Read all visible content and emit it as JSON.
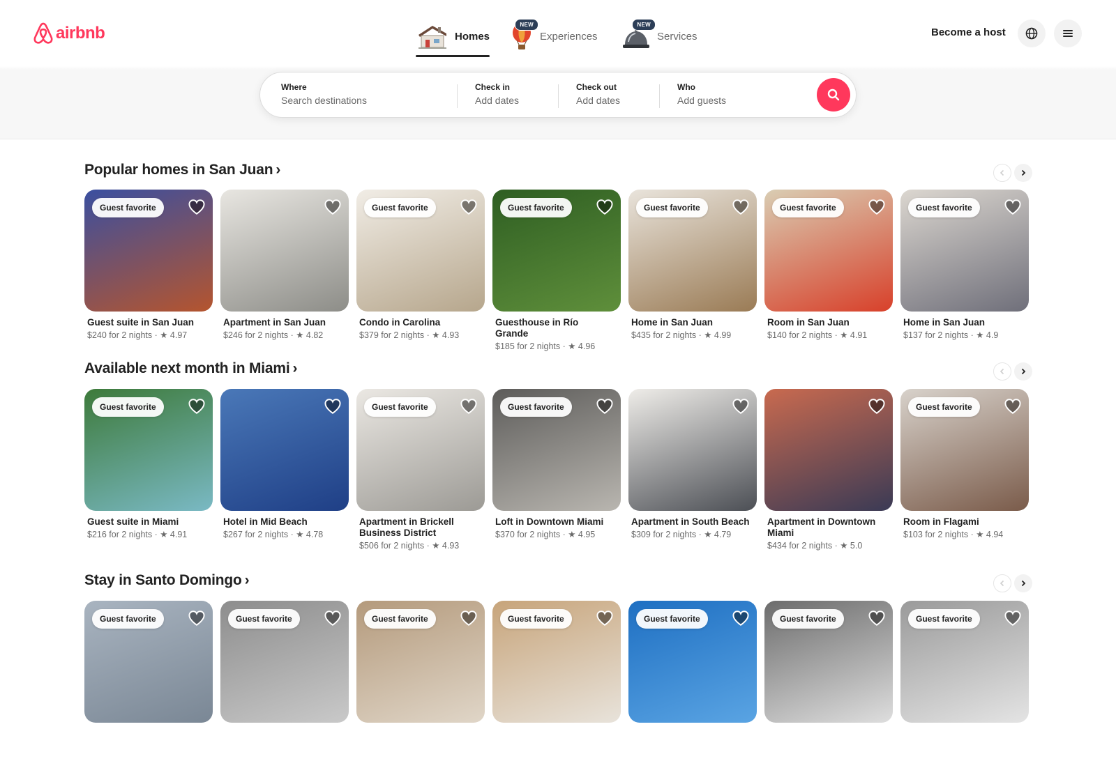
{
  "brand": {
    "name": "airbnb",
    "color": "#ff385c"
  },
  "nav": {
    "tabs": [
      {
        "label": "Homes",
        "icon": "house-icon",
        "active": true,
        "badge": ""
      },
      {
        "label": "Experiences",
        "icon": "hot-air-balloon-icon",
        "active": false,
        "badge": "NEW"
      },
      {
        "label": "Services",
        "icon": "service-bell-icon",
        "active": false,
        "badge": "NEW"
      }
    ],
    "become_host": "Become a host",
    "globe_icon": "globe-icon",
    "menu_icon": "hamburger-menu-icon"
  },
  "search": {
    "where_label": "Where",
    "where_placeholder": "Search destinations",
    "checkin_label": "Check in",
    "checkin_placeholder": "Add dates",
    "checkout_label": "Check out",
    "checkout_placeholder": "Add dates",
    "who_label": "Who",
    "who_placeholder": "Add guests",
    "button_icon": "search-icon"
  },
  "sections": [
    {
      "title": "Popular homes in San Juan",
      "listings": [
        {
          "title": "Guest suite in San Juan",
          "meta": "$240 for 2 nights · ★ 4.97",
          "badge": "Guest favorite",
          "c1": "#3a4fa0",
          "c2": "#b5552e"
        },
        {
          "title": "Apartment in San Juan",
          "meta": "$246 for 2 nights · ★ 4.82",
          "badge": "",
          "c1": "#e8e6e1",
          "c2": "#8d8d88"
        },
        {
          "title": "Condo in Carolina",
          "meta": "$379 for 2 nights · ★ 4.93",
          "badge": "Guest favorite",
          "c1": "#f1ede6",
          "c2": "#b6a68c"
        },
        {
          "title": "Guesthouse in Río Grande",
          "meta": "$185 for 2 nights · ★ 4.96",
          "badge": "Guest favorite",
          "c1": "#2e5e22",
          "c2": "#5f8f3b"
        },
        {
          "title": "Home in San Juan",
          "meta": "$435 for 2 nights · ★ 4.99",
          "badge": "Guest favorite",
          "c1": "#e9e4dc",
          "c2": "#9a7b55"
        },
        {
          "title": "Room in San Juan",
          "meta": "$140 for 2 nights · ★ 4.91",
          "badge": "Guest favorite",
          "c1": "#d9cdb3",
          "c2": "#d8402a"
        },
        {
          "title": "Home in San Juan",
          "meta": "$137 for 2 nights · ★ 4.9",
          "badge": "Guest favorite",
          "c1": "#dcd7d0",
          "c2": "#6f6f7a"
        }
      ]
    },
    {
      "title": "Available next month in Miami",
      "listings": [
        {
          "title": "Guest suite in Miami",
          "meta": "$216 for 2 nights · ★ 4.91",
          "badge": "Guest favorite",
          "c1": "#3d7a3a",
          "c2": "#7ab9c4"
        },
        {
          "title": "Hotel in Mid Beach",
          "meta": "$267 for 2 nights · ★ 4.78",
          "badge": "",
          "c1": "#4a78b8",
          "c2": "#1f3f86"
        },
        {
          "title": "Apartment in Brickell Business District",
          "meta": "$506 for 2 nights · ★ 4.93",
          "badge": "Guest favorite",
          "c1": "#ebe8e3",
          "c2": "#9c9a95"
        },
        {
          "title": "Loft in Downtown Miami",
          "meta": "$370 for 2 nights · ★ 4.95",
          "badge": "Guest favorite",
          "c1": "#5d5c5a",
          "c2": "#b9b6b0"
        },
        {
          "title": "Apartment in South Beach",
          "meta": "$309 for 2 nights · ★ 4.79",
          "badge": "",
          "c1": "#efede9",
          "c2": "#4c4f55"
        },
        {
          "title": "Apartment in Downtown Miami",
          "meta": "$434 for 2 nights · ★ 5.0",
          "badge": "",
          "c1": "#c96a4f",
          "c2": "#3a3a55"
        },
        {
          "title": "Room in Flagami",
          "meta": "$103 for 2 nights · ★ 4.94",
          "badge": "Guest favorite",
          "c1": "#d8d2cb",
          "c2": "#7a5b4a"
        }
      ]
    },
    {
      "title": "Stay in Santo Domingo",
      "listings": [
        {
          "title": "",
          "meta": "",
          "badge": "Guest favorite",
          "c1": "#a9b4c0",
          "c2": "#7a8795"
        },
        {
          "title": "",
          "meta": "",
          "badge": "Guest favorite",
          "c1": "#8d8d8d",
          "c2": "#c9c9c9"
        },
        {
          "title": "",
          "meta": "",
          "badge": "Guest favorite",
          "c1": "#b49a7c",
          "c2": "#e0d6c8"
        },
        {
          "title": "",
          "meta": "",
          "badge": "Guest favorite",
          "c1": "#c7a47a",
          "c2": "#e8e3db"
        },
        {
          "title": "",
          "meta": "",
          "badge": "Guest favorite",
          "c1": "#1e6fc2",
          "c2": "#5aa4e3"
        },
        {
          "title": "",
          "meta": "",
          "badge": "Guest favorite",
          "c1": "#6c6c6c",
          "c2": "#dedede"
        },
        {
          "title": "",
          "meta": "",
          "badge": "Guest favorite",
          "c1": "#9a9a9a",
          "c2": "#e4e4e4"
        }
      ]
    }
  ]
}
